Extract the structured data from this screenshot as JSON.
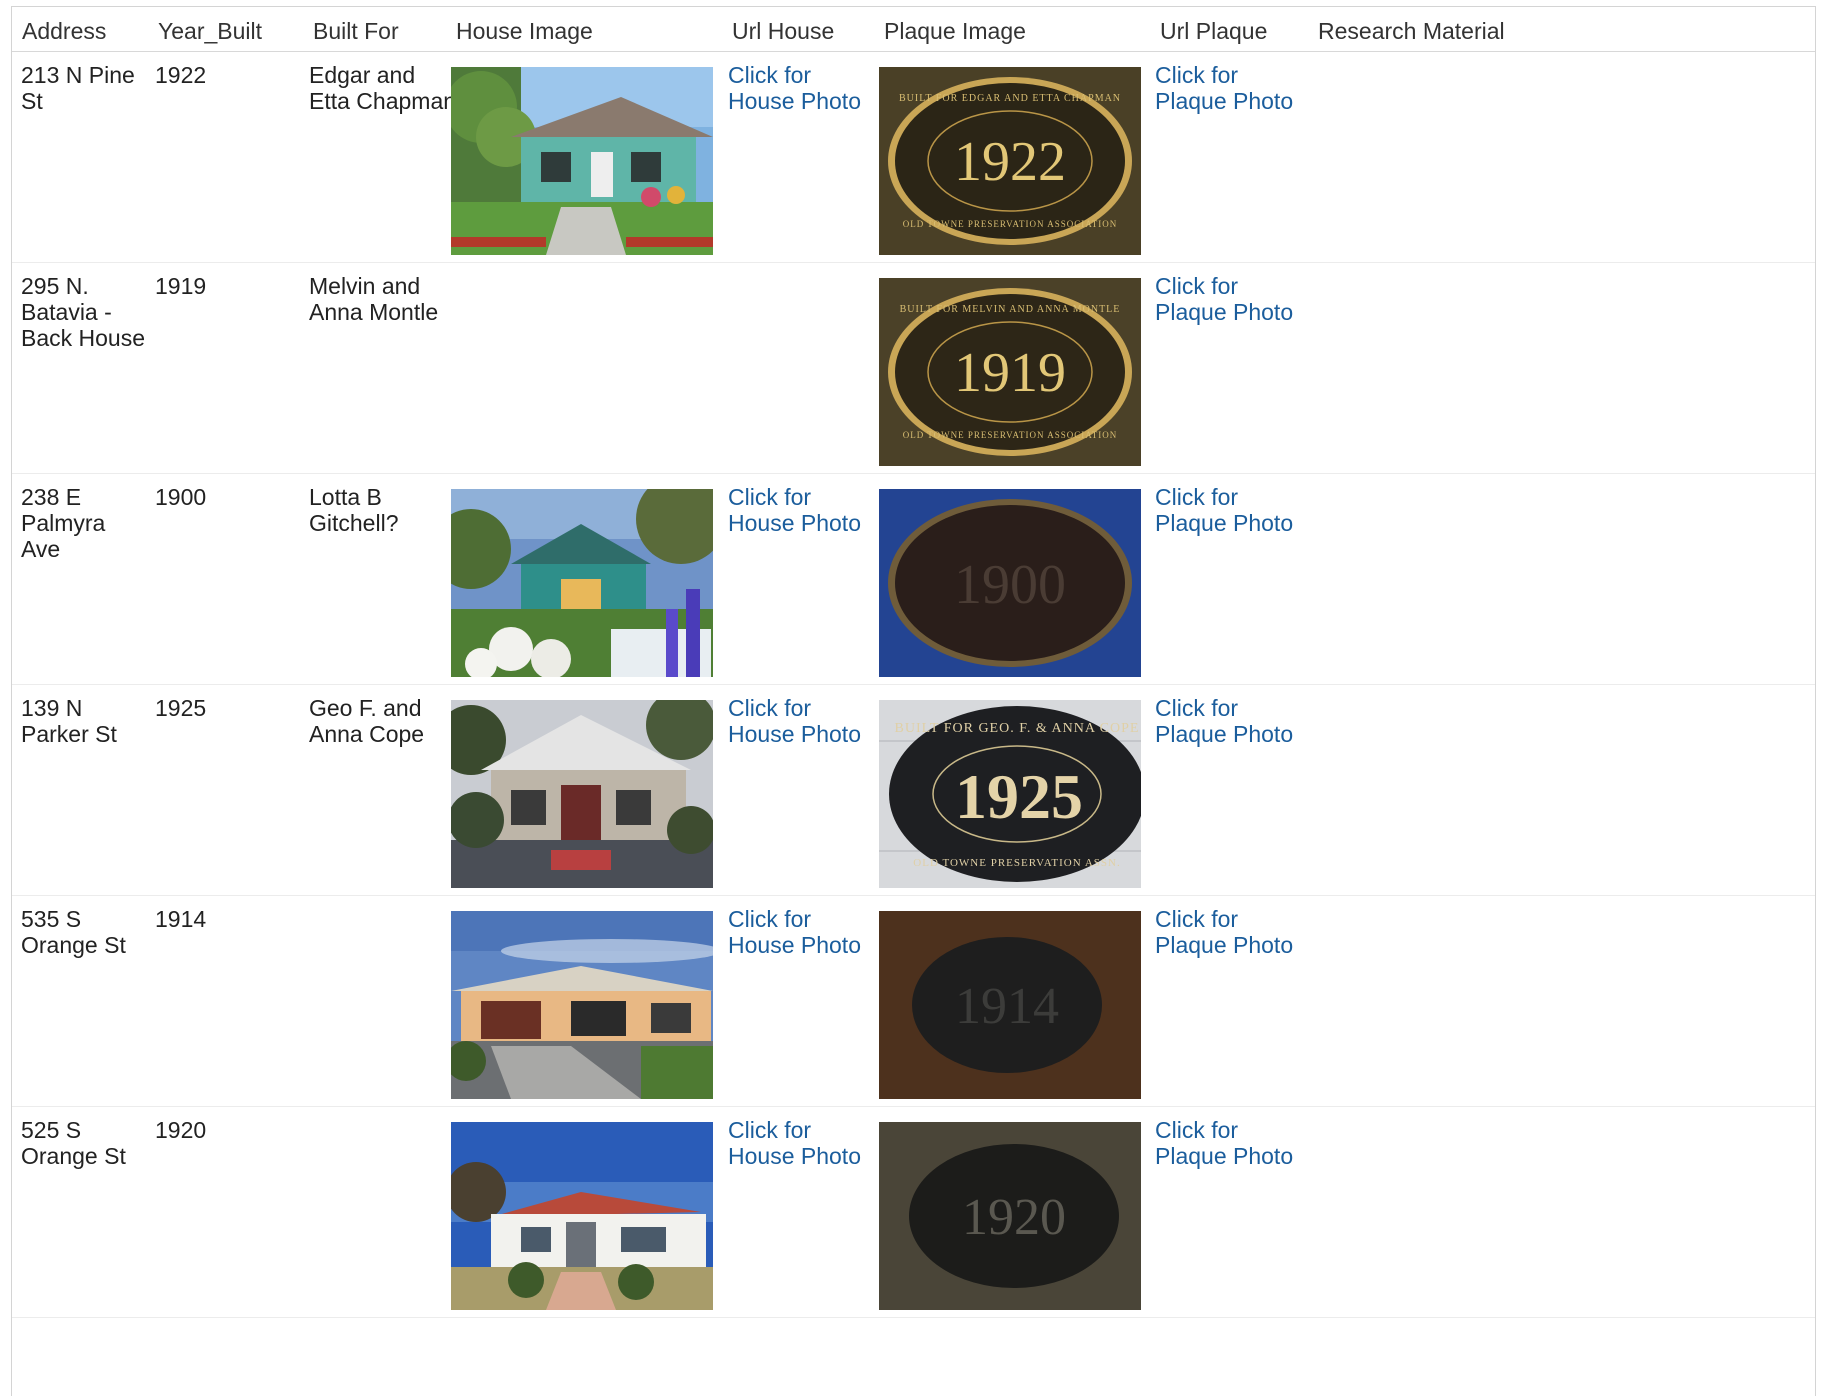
{
  "table": {
    "headers": {
      "address": "Address",
      "year_built": "Year_Built",
      "built_for": "Built For",
      "house_image": "House Image",
      "url_house": "Url House",
      "plaque_image": "Plaque Image",
      "url_plaque": "Url Plaque",
      "research_material": "Research Material"
    },
    "rows": [
      {
        "address": "213 N Pine St",
        "year_built": "1922",
        "built_for": "Edgar and Etta Chapman",
        "url_house": "Click for House Photo",
        "url_plaque": "Click for Plaque Photo",
        "plaque": {
          "year": "1922",
          "top_text": "BUILT FOR EDGAR AND ETTA CHAPMAN",
          "bottom_text": "OLD TOWNE PRESERVATION ASSOCIATION"
        }
      },
      {
        "address": "295 N. Batavia - Back House",
        "year_built": "1919",
        "built_for": "Melvin and Anna Montle",
        "url_house": "",
        "url_plaque": "Click for Plaque Photo",
        "plaque": {
          "year": "1919",
          "top_text": "BUILT FOR MELVIN AND ANNA MONTLE",
          "bottom_text": "OLD TOWNE PRESERVATION ASSOCIATION"
        }
      },
      {
        "address": "238 E Palmyra Ave",
        "year_built": "1900",
        "built_for": "Lotta B Gitchell?",
        "url_house": "Click for House Photo",
        "url_plaque": "Click for Plaque Photo",
        "plaque": {
          "year": "1900"
        }
      },
      {
        "address": "139 N Parker St",
        "year_built": "1925",
        "built_for": "Geo F. and Anna Cope",
        "url_house": "Click for House Photo",
        "url_plaque": "Click for Plaque Photo",
        "plaque": {
          "year": "1925",
          "top_text": "BUILT FOR GEO. F. & ANNA COPE",
          "bottom_text": "OLD TOWNE PRESERVATION ASSN."
        }
      },
      {
        "address": "535 S Orange St",
        "year_built": "1914",
        "built_for": "",
        "url_house": "Click for House Photo",
        "url_plaque": "Click for Plaque Photo",
        "plaque": {
          "year": "1914"
        }
      },
      {
        "address": "525 S Orange St",
        "year_built": "1920",
        "built_for": "",
        "url_house": "Click for House Photo",
        "url_plaque": "Click for Plaque Photo",
        "plaque": {
          "year": "1920"
        }
      }
    ]
  },
  "colors": {
    "link": "#1b5d9c",
    "text": "#222222",
    "header_text": "#333333",
    "border": "#d4d4d4"
  }
}
